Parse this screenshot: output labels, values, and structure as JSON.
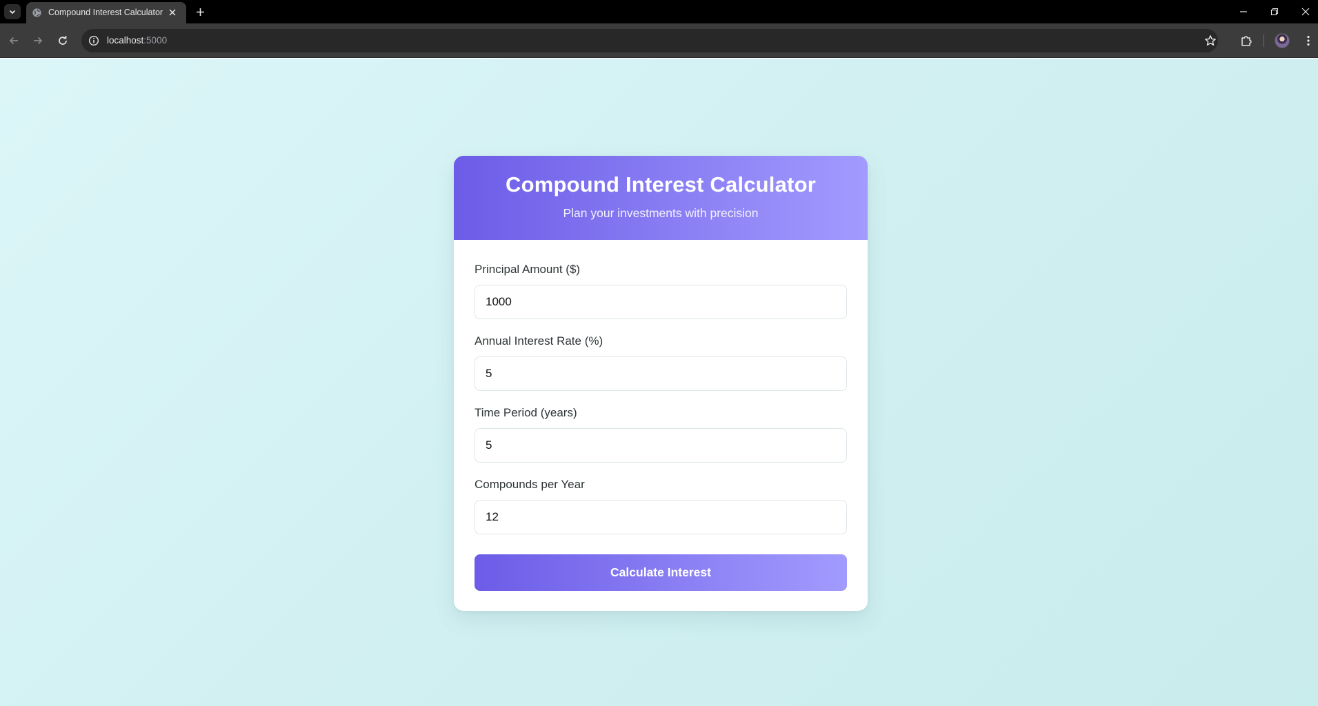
{
  "browser": {
    "tab_title": "Compound Interest Calculator",
    "url_host": "localhost",
    "url_port": ":5000",
    "icons": {
      "tab_list": "chevron-down-icon",
      "favicon": "globe-icon",
      "tab_close": "close-icon",
      "new_tab": "plus-icon",
      "minimize": "minimize-icon",
      "restore": "restore-icon",
      "close_window": "close-icon",
      "back": "back-arrow-icon",
      "forward": "forward-arrow-icon",
      "reload": "reload-icon",
      "site_info": "info-icon",
      "bookmark": "star-icon",
      "extensions": "puzzle-icon",
      "profile": "avatar",
      "menu": "kebab-menu-icon"
    }
  },
  "calculator": {
    "title": "Compound Interest Calculator",
    "subtitle": "Plan your investments with precision",
    "fields": [
      {
        "label": "Principal Amount ($)",
        "value": "1000"
      },
      {
        "label": "Annual Interest Rate (%)",
        "value": "5"
      },
      {
        "label": "Time Period (years)",
        "value": "5"
      },
      {
        "label": "Compounds per Year",
        "value": "12"
      }
    ],
    "submit_label": "Calculate Interest"
  },
  "colors": {
    "accent_start": "#6c5ce7",
    "accent_end": "#a29bfe",
    "page_background": "#d2f0f2",
    "card_background": "#ffffff",
    "label_text": "#2d3436"
  }
}
